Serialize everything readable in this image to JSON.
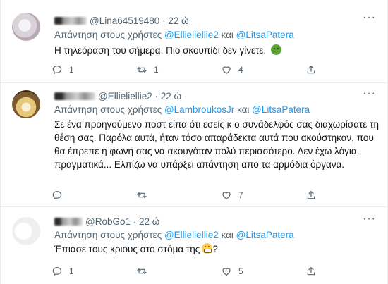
{
  "tweets": [
    {
      "name": "L.....",
      "handle": "@Lina64519480",
      "dot": "·",
      "time": "22 ώ",
      "reply_prefix": "Απάντηση στους χρήστες",
      "reply_mentions": [
        "@Ellieliellie2",
        "@LitsaPatera"
      ],
      "reply_and": "και",
      "text": "Η τηλεόραση του σήμερα. Πιο σκουπίδι δεν γίνετε.",
      "emoji": "sick-face-icon",
      "more": "···",
      "counts": {
        "reply": "1",
        "retweet": "1",
        "like": "4"
      }
    },
    {
      "name": "L...",
      "handle": "@Ellieliellie2",
      "dot": "·",
      "time": "22 ώ",
      "reply_prefix": "Απάντηση στους χρήστες",
      "reply_mentions": [
        "@LambroukosJr",
        "@LitsaPatera"
      ],
      "reply_and": "και",
      "text": "Σε ένα προηγούμενο ποστ είπα ότι εσείς κ ο συνάδελφός σας διαχωρίσατε τη θέση σας. Παρόλα αυτά, ήταν τόσο απαράδεκτα αυτά που ακούστηκαν, που θα έπρεπε η φωνή σας να ακουγόταν πολύ περισσότερο. Δεν έχω λόγια, πραγματικά... Ελπίζω να υπάρξει απάντηση απο τα αρμόδια όργανα.",
      "more": "···",
      "counts": {
        "reply": "",
        "retweet": "",
        "like": "7"
      }
    },
    {
      "name": "Ro...",
      "handle": "@RobGo1",
      "dot": "·",
      "time": "22 ώ",
      "reply_prefix": "Απάντηση στους χρήστες",
      "reply_mentions": [
        "@Ellieliellie2",
        "@LitsaPatera"
      ],
      "reply_and": "και",
      "text": "Έπιασε τους κριους στο στόμα της",
      "text_suffix": "?",
      "emoji": "grimace-face-icon",
      "more": "···",
      "counts": {
        "reply": "1",
        "retweet": "",
        "like": "5"
      }
    }
  ],
  "colors": {
    "mention": "#1d9bf0",
    "muted": "#536471",
    "text": "#0f1419"
  }
}
